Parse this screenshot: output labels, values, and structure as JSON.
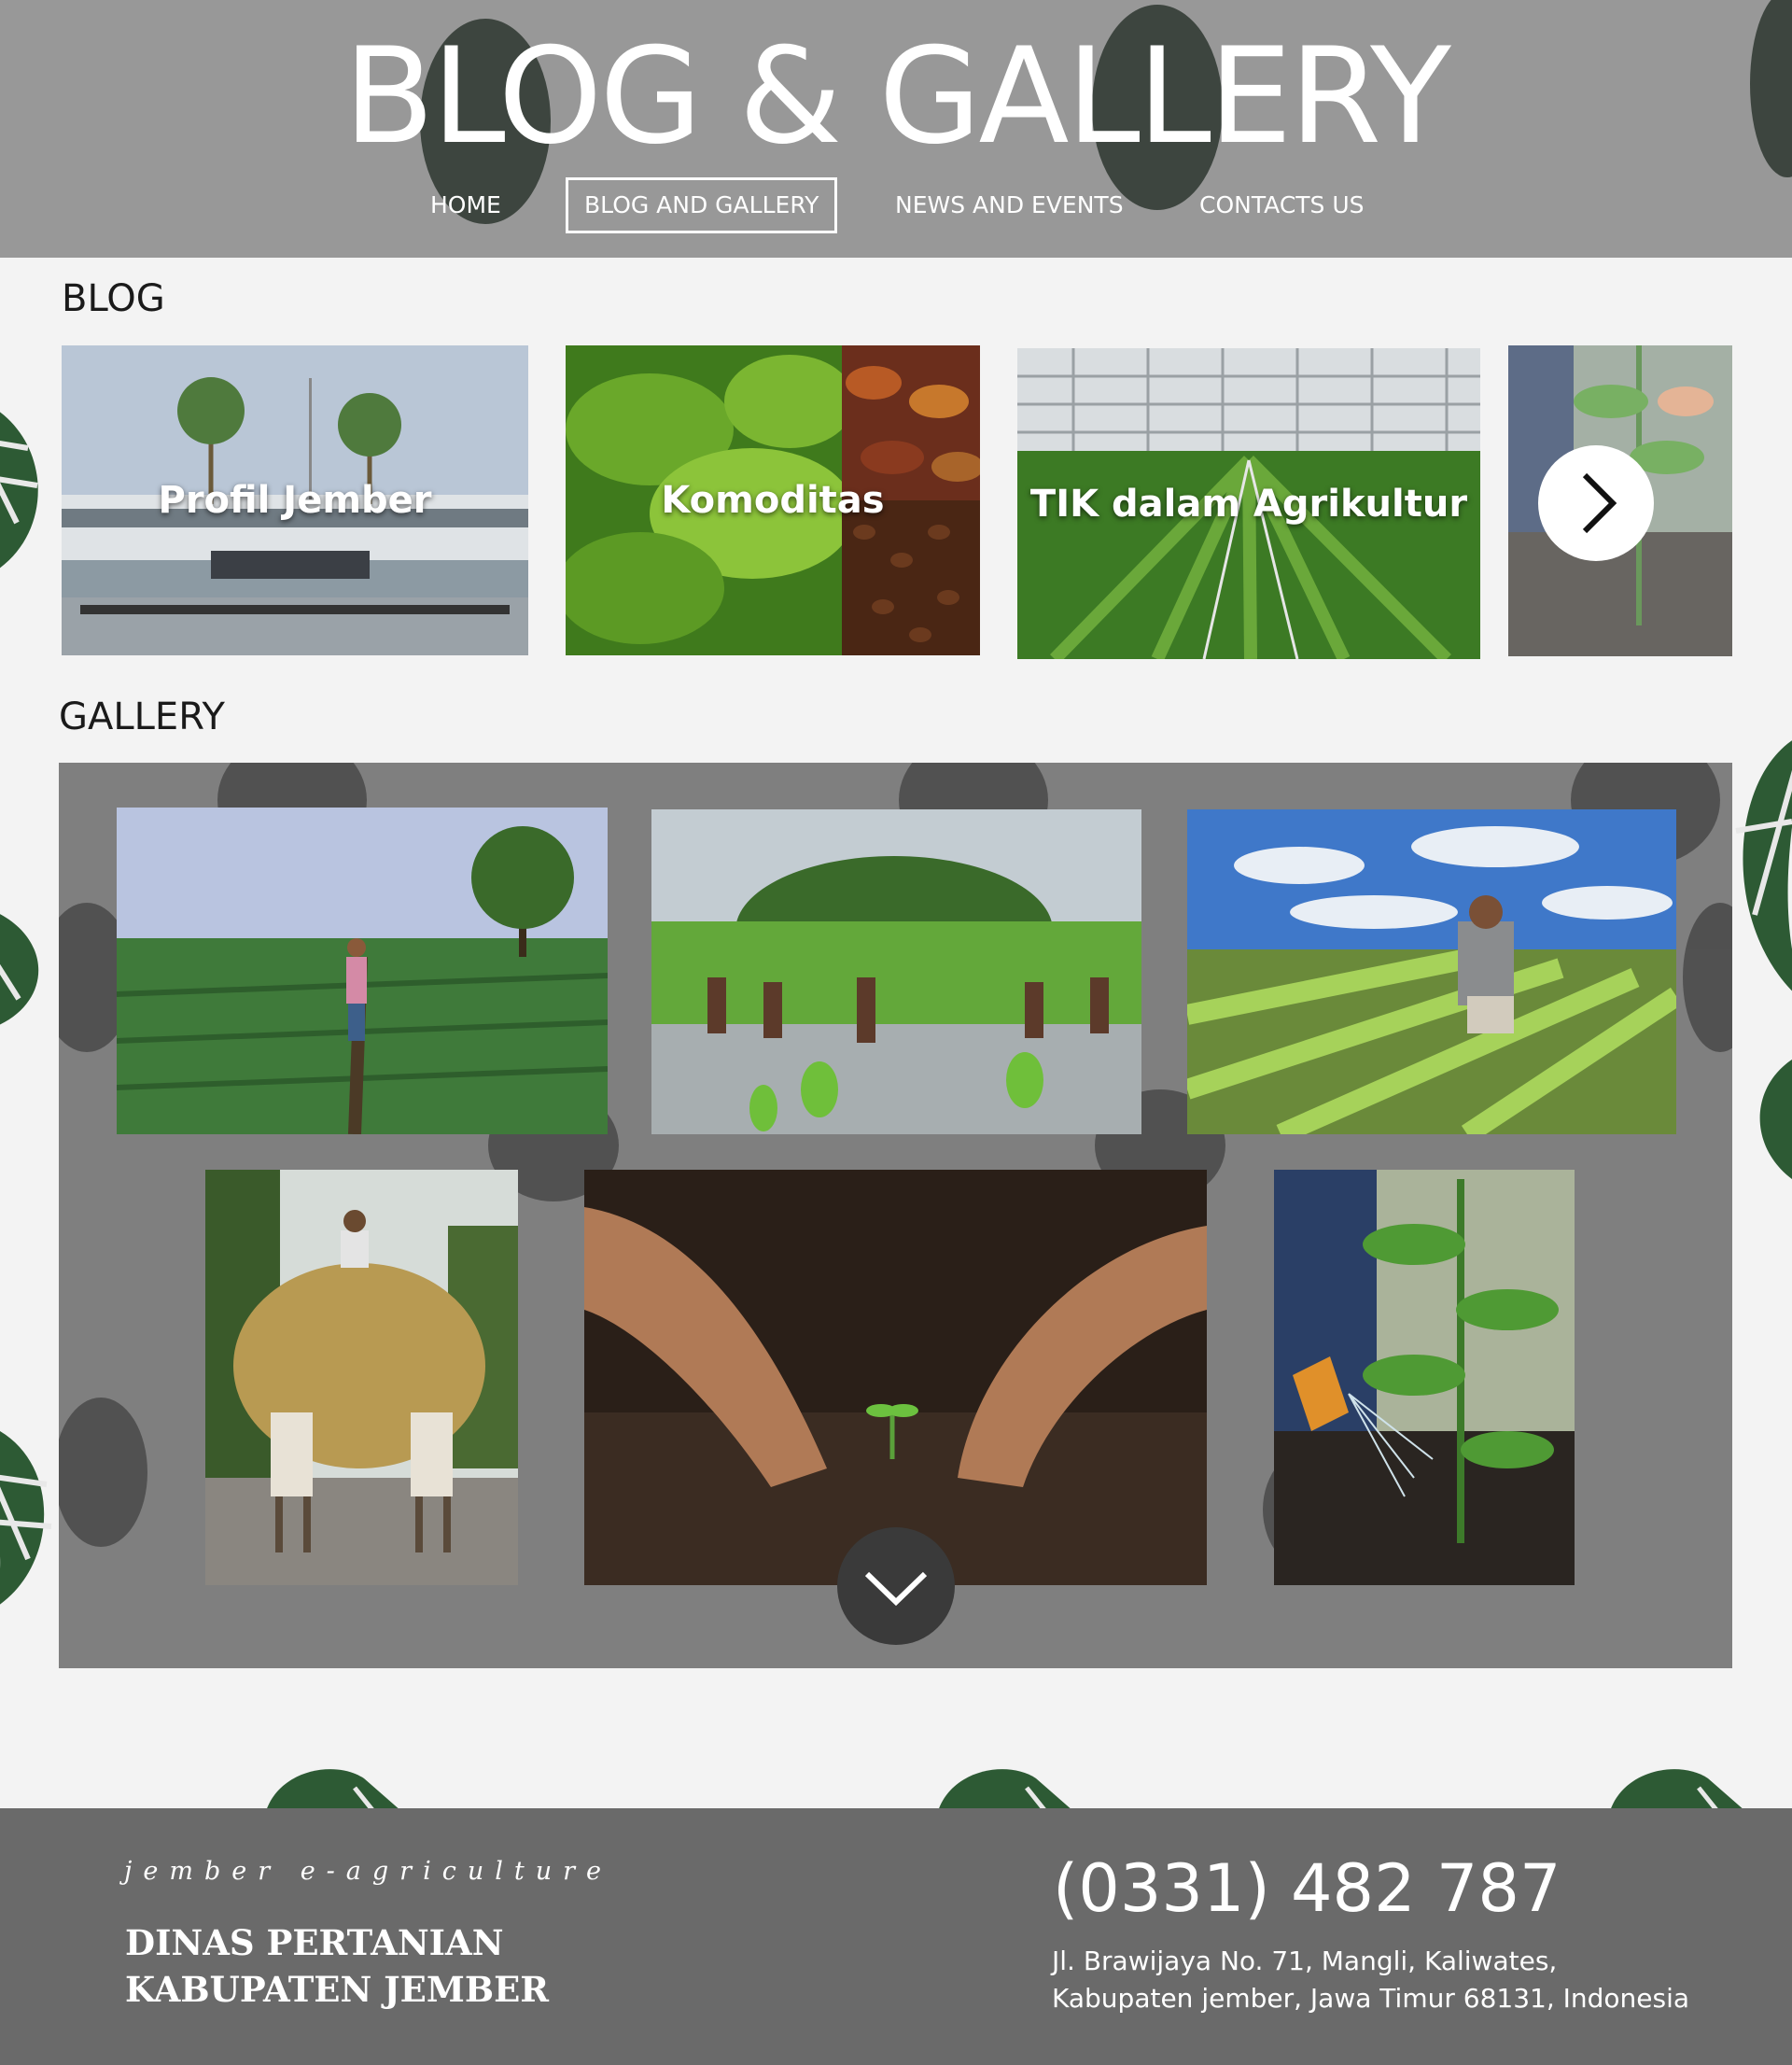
{
  "header": {
    "site_title": "BLOG & GALLERY",
    "nav": [
      {
        "label": "HOME",
        "active": false
      },
      {
        "label": "BLOG AND GALLERY",
        "active": true
      },
      {
        "label": "NEWS AND EVENTS",
        "active": false
      },
      {
        "label": "CONTACTS US",
        "active": false
      }
    ]
  },
  "blog": {
    "title": "BLOG",
    "cards": [
      {
        "label": "Profil Jember",
        "image": "kantor bupati jember building"
      },
      {
        "label": "Komoditas",
        "image": "tobacco leaves, cacao pods and coffee beans"
      },
      {
        "label": "TIK dalam Agrikultur",
        "image": "greenhouse with irrigation"
      },
      {
        "label": "",
        "image": "hand watering tomato seedling"
      }
    ],
    "next_icon": "chevron-right-icon"
  },
  "gallery": {
    "title": "GALLERY",
    "images": [
      "farmer walking in green field",
      "workers planting rice in paddy",
      "farmer tending lettuce rows",
      "ox cart loaded with hay",
      "hands planting seedling in soil",
      "watering tomato plant"
    ],
    "more_icon": "chevron-down-icon"
  },
  "footer": {
    "tagline": "jember e-agriculture",
    "org_line1": "DINAS PERTANIAN",
    "org_line2": "KABUPATEN JEMBER",
    "phone": "(0331) 482 787",
    "address_line1": "Jl. Brawijaya No. 71, Mangli, Kaliwates,",
    "address_line2": "Kabupaten jember, Jawa Timur 68131, Indonesia"
  },
  "colors": {
    "header_bg": "#989898",
    "page_bg": "#f3f3f3",
    "gallery_bg": "#7f7f7f",
    "footer_bg": "#6a6a6a",
    "leaf": "#2d5a34"
  }
}
